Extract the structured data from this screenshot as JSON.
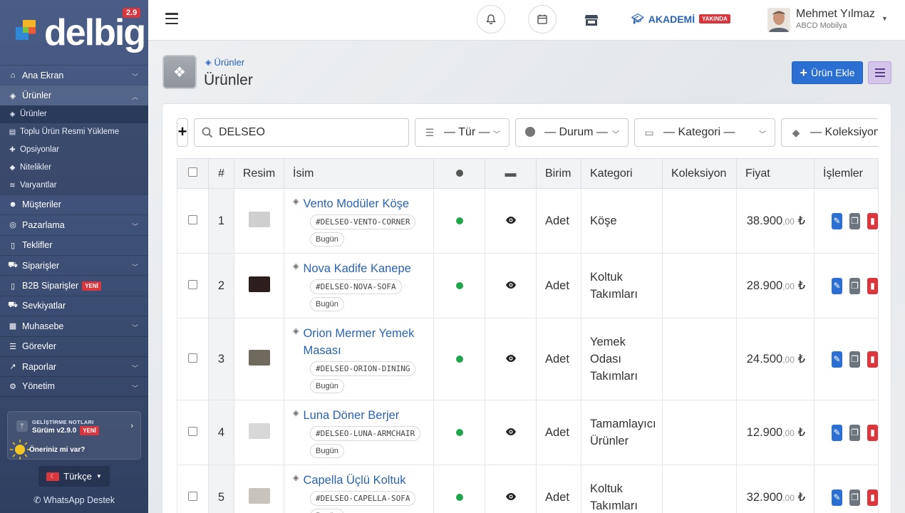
{
  "sidebar": {
    "logo_text": "delbig",
    "version_badge": "2.9",
    "items": [
      {
        "label": "Ana Ekran",
        "icon": "home-icon"
      },
      {
        "label": "Ürünler",
        "icon": "cubes-icon"
      },
      {
        "label": "Müşteriler",
        "icon": "users-icon"
      },
      {
        "label": "Pazarlama",
        "icon": "target-icon"
      },
      {
        "label": "Teklifler",
        "icon": "file-icon"
      },
      {
        "label": "Siparişler",
        "icon": "cart-icon"
      },
      {
        "label": "B2B Siparişler",
        "icon": "file-icon",
        "badge": "YENİ"
      },
      {
        "label": "Sevkiyatlar",
        "icon": "truck-icon"
      },
      {
        "label": "Muhasebe",
        "icon": "calculator-icon"
      },
      {
        "label": "Görevler",
        "icon": "list-icon"
      },
      {
        "label": "Raporlar",
        "icon": "chart-icon"
      },
      {
        "label": "Yönetim",
        "icon": "gears-icon"
      }
    ],
    "sub_items": [
      {
        "label": "Ürünler"
      },
      {
        "label": "Toplu Ürün Resmi Yükleme"
      },
      {
        "label": "Opsiyonlar"
      },
      {
        "label": "Nitelikler"
      },
      {
        "label": "Varyantlar"
      }
    ],
    "dev_notes": {
      "title": "GELİŞTİRME NOTLARI",
      "version": "Sürüm v2.9.0",
      "badge": "YENİ",
      "question": "Öneriniz mi var?"
    },
    "language": "Türkçe",
    "whatsapp": "WhatsApp Destek"
  },
  "topbar": {
    "akademi": "AKADEMİ",
    "akademi_badge": "YAKINDA",
    "user_name": "Mehmet Yılmaz",
    "user_company": "ABCD Mobilya"
  },
  "page": {
    "breadcrumb": "Ürünler",
    "title": "Ürünler",
    "add_button": "Ürün Ekle"
  },
  "filters": {
    "search_value": "DELSEO",
    "tur": "— Tür —",
    "durum": "— Durum —",
    "kategori": "— Kategori —",
    "koleksiyon": "— Koleksiyon —"
  },
  "table": {
    "headers": {
      "num": "#",
      "image": "Resim",
      "name": "İsim",
      "unit": "Birim",
      "category": "Kategori",
      "collection": "Koleksiyon",
      "price": "Fiyat",
      "actions": "İşlemler"
    },
    "rows": [
      {
        "num": "1",
        "name": "Vento Modüler Köşe",
        "sku": "#DELSEO-VENTO-CORNER",
        "date": "Bugün",
        "unit": "Adet",
        "category": "Köşe",
        "collection": "",
        "price_main": "38.900",
        "price_dec": ",00",
        "currency": "₺",
        "thumb_color": "#cfcfcf"
      },
      {
        "num": "2",
        "name": "Nova Kadife Kanepe",
        "sku": "#DELSEO-NOVA-SOFA",
        "date": "Bugün",
        "unit": "Adet",
        "category": "Koltuk Takımları",
        "collection": "",
        "price_main": "28.900",
        "price_dec": ",00",
        "currency": "₺",
        "thumb_color": "#2b1e1c"
      },
      {
        "num": "3",
        "name": "Orion Mermer Yemek Masası",
        "sku": "#DELSEO-ORION-DINING",
        "date": "Bugün",
        "unit": "Adet",
        "category": "Yemek Odası Takımları",
        "collection": "",
        "price_main": "24.500",
        "price_dec": ",00",
        "currency": "₺",
        "thumb_color": "#6f6a5d"
      },
      {
        "num": "4",
        "name": "Luna Döner Berjer",
        "sku": "#DELSEO-LUNA-ARMCHAIR",
        "date": "Bugün",
        "unit": "Adet",
        "category": "Tamamlayıcı Ürünler",
        "collection": "",
        "price_main": "12.900",
        "price_dec": ",00",
        "currency": "₺",
        "thumb_color": "#d8d8d8"
      },
      {
        "num": "5",
        "name": "Capella Üçlü Koltuk",
        "sku": "#DELSEO-CAPELLA-SOFA",
        "date": "Bugün",
        "unit": "Adet",
        "category": "Koltuk Takımları",
        "collection": "",
        "price_main": "32.900",
        "price_dec": ",00",
        "currency": "₺",
        "thumb_color": "#c9c4bb"
      }
    ]
  },
  "colors": {
    "accent": "#2a6fd1",
    "sidebar": "#3c4e74",
    "danger": "#d9363e",
    "success": "#1fa64a"
  }
}
